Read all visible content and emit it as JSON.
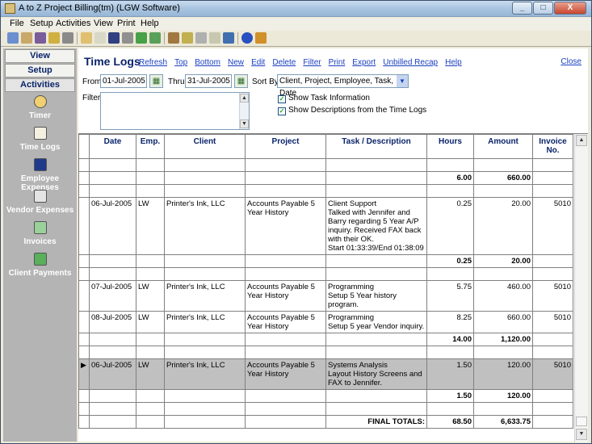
{
  "window": {
    "title": "A to Z Project Billing(tm)  (LGW Software)",
    "min": "_",
    "max": "□",
    "close": "X"
  },
  "menu": [
    "File",
    "Setup",
    "Activities",
    "View",
    "Print",
    "Help"
  ],
  "sidebar": {
    "tabs": [
      "View",
      "Setup",
      "Activities"
    ],
    "items": [
      "Timer",
      "Time Logs",
      "Employee Expenses",
      "Vendor Expenses",
      "Invoices",
      "Client Payments"
    ]
  },
  "header": {
    "title": "Time Logs",
    "links": [
      "Refresh",
      "Top",
      "Bottom",
      "New",
      "Edit",
      "Delete",
      "Filter",
      "Print",
      "Export",
      "Unbilled Recap",
      "Help"
    ],
    "close": "Close"
  },
  "controls": {
    "from_label": "From:",
    "from_value": "01-Jul-2005",
    "thru_label": "Thru:",
    "thru_value": "31-Jul-2005",
    "sort_label": "Sort By:",
    "sort_value": "Client, Project, Employee, Task, Date",
    "filter_label": "Filter:",
    "show_task": "Show Task Information",
    "show_desc": "Show Descriptions from the Time Logs"
  },
  "table": {
    "headers": [
      "Date",
      "Emp.",
      "Client",
      "Project",
      "Task / Description",
      "Hours",
      "Amount",
      "Invoice No."
    ],
    "rows": [
      {
        "date": "",
        "emp": "",
        "client": "",
        "project": "",
        "task": "",
        "hours": "",
        "amount": "",
        "inv": "",
        "type": "blank"
      },
      {
        "date": "",
        "emp": "",
        "client": "",
        "project": "",
        "task": "",
        "hours": "6.00",
        "amount": "660.00",
        "inv": "",
        "type": "total"
      },
      {
        "date": "",
        "emp": "",
        "client": "",
        "project": "",
        "task": "",
        "hours": "",
        "amount": "",
        "inv": "",
        "type": "blank"
      },
      {
        "date": "06-Jul-2005",
        "emp": "LW",
        "client": "Printer's Ink, LLC",
        "project": "Accounts Payable 5 Year History",
        "task": "Client Support\nTalked with Jennifer and Barry regarding 5 Year A/P inquiry. Received FAX back with their OK.\nStart 01:33:39/End 01:38:09",
        "hours": "0.25",
        "amount": "20.00",
        "inv": "5010",
        "type": "data"
      },
      {
        "date": "",
        "emp": "",
        "client": "",
        "project": "",
        "task": "",
        "hours": "0.25",
        "amount": "20.00",
        "inv": "",
        "type": "total"
      },
      {
        "date": "",
        "emp": "",
        "client": "",
        "project": "",
        "task": "",
        "hours": "",
        "amount": "",
        "inv": "",
        "type": "blank"
      },
      {
        "date": "07-Jul-2005",
        "emp": "LW",
        "client": "Printer's Ink, LLC",
        "project": "Accounts Payable 5 Year History",
        "task": "Programming\nSetup 5 Year history program.",
        "hours": "5.75",
        "amount": "460.00",
        "inv": "5010",
        "type": "data"
      },
      {
        "date": "08-Jul-2005",
        "emp": "LW",
        "client": "Printer's Ink, LLC",
        "project": "Accounts Payable 5 Year History",
        "task": "Programming\nSetup 5 year Vendor inquiry.",
        "hours": "8.25",
        "amount": "660.00",
        "inv": "5010",
        "type": "data"
      },
      {
        "date": "",
        "emp": "",
        "client": "",
        "project": "",
        "task": "",
        "hours": "14.00",
        "amount": "1,120.00",
        "inv": "",
        "type": "total"
      },
      {
        "date": "",
        "emp": "",
        "client": "",
        "project": "",
        "task": "",
        "hours": "",
        "amount": "",
        "inv": "",
        "type": "blank"
      },
      {
        "date": "06-Jul-2005",
        "emp": "LW",
        "client": "Printer's Ink, LLC",
        "project": "Accounts Payable 5 Year History",
        "task": "Systems Analysis\nLayout History Screens and FAX to Jennifer.",
        "hours": "1.50",
        "amount": "120.00",
        "inv": "5010",
        "type": "selected"
      },
      {
        "date": "",
        "emp": "",
        "client": "",
        "project": "",
        "task": "",
        "hours": "1.50",
        "amount": "120.00",
        "inv": "",
        "type": "total"
      },
      {
        "date": "",
        "emp": "",
        "client": "",
        "project": "",
        "task": "",
        "hours": "",
        "amount": "",
        "inv": "",
        "type": "blank"
      },
      {
        "date": "",
        "emp": "",
        "client": "",
        "project": "",
        "task": "FINAL TOTALS:",
        "hours": "68.50",
        "amount": "6,633.75",
        "inv": "",
        "type": "final"
      }
    ]
  }
}
